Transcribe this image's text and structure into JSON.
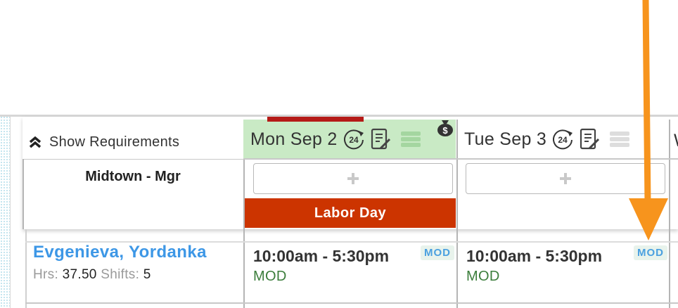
{
  "toolbar": {
    "show_requirements_label": "Show Requirements"
  },
  "location": {
    "label": "Midtown - Mgr"
  },
  "days": [
    {
      "label": "Mon Sep 2",
      "icon_24": "24",
      "holiday": "Labor Day",
      "holiday_color": "#cc3400",
      "header_color": "#c9eac5"
    },
    {
      "label": "Tue Sep 3",
      "icon_24": "24",
      "header_color": "#ffffff"
    }
  ],
  "next_day_stub": "W",
  "employee": {
    "name": "Evgenieva, Yordanka",
    "hrs_label": "Hrs:",
    "hrs_value": "37.50",
    "shifts_label": "Shifts:",
    "shifts_value": "5"
  },
  "shifts": [
    {
      "time": "10:00am - 5:30pm",
      "position": "MOD",
      "badge": "MOD"
    },
    {
      "time": "10:00am - 5:30pm",
      "position": "MOD",
      "badge": "MOD"
    }
  ],
  "colors": {
    "accent_link": "#3d97e6",
    "annotation_arrow": "#f7941d",
    "position_green": "#3b7d3b"
  },
  "icons": [
    "double-chevron-up-icon",
    "money-bag-icon",
    "24-hour-icon",
    "notes-icon",
    "stack-icon",
    "plus-icon",
    "arrow-annotation"
  ]
}
